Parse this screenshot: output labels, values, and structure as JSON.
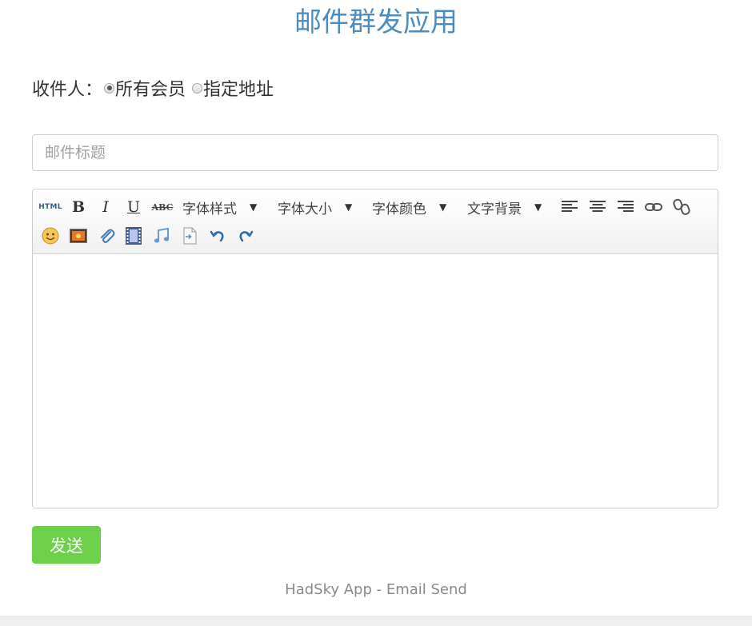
{
  "page": {
    "title": "邮件群发应用"
  },
  "recipients": {
    "label": "收件人：",
    "options": [
      {
        "label": "所有会员",
        "checked": true
      },
      {
        "label": "指定地址",
        "checked": false
      }
    ]
  },
  "subject": {
    "placeholder": "邮件标题",
    "value": ""
  },
  "editor": {
    "toolbar": {
      "buttons": [
        {
          "icon": "html-icon",
          "tooltip": "HTML"
        },
        {
          "icon": "bold-icon",
          "glyph": "B"
        },
        {
          "icon": "italic-icon",
          "glyph": "I"
        },
        {
          "icon": "underline-icon",
          "glyph": "U"
        },
        {
          "icon": "strikethrough-icon",
          "glyph": "ABC"
        },
        {
          "icon": "align-left-icon"
        },
        {
          "icon": "align-center-icon"
        },
        {
          "icon": "align-right-icon"
        },
        {
          "icon": "link-icon"
        },
        {
          "icon": "unlink-icon"
        },
        {
          "icon": "emoticon-icon"
        },
        {
          "icon": "image-icon"
        },
        {
          "icon": "attachment-icon"
        },
        {
          "icon": "video-icon"
        },
        {
          "icon": "music-icon"
        },
        {
          "icon": "insert-file-icon"
        },
        {
          "icon": "undo-icon"
        },
        {
          "icon": "redo-icon"
        }
      ],
      "font_style": "字体样式",
      "font_size": "字体大小",
      "font_color": "字体颜色",
      "text_background": "文字背景",
      "dropdown_arrow": "▼"
    },
    "content": ""
  },
  "send_button": {
    "label": "发送"
  },
  "footer": {
    "text": "HadSky App - Email Send"
  },
  "colors": {
    "title": "#4a8cc4",
    "send_button": "#6cd04a",
    "footer_text": "#8a8a8a"
  }
}
